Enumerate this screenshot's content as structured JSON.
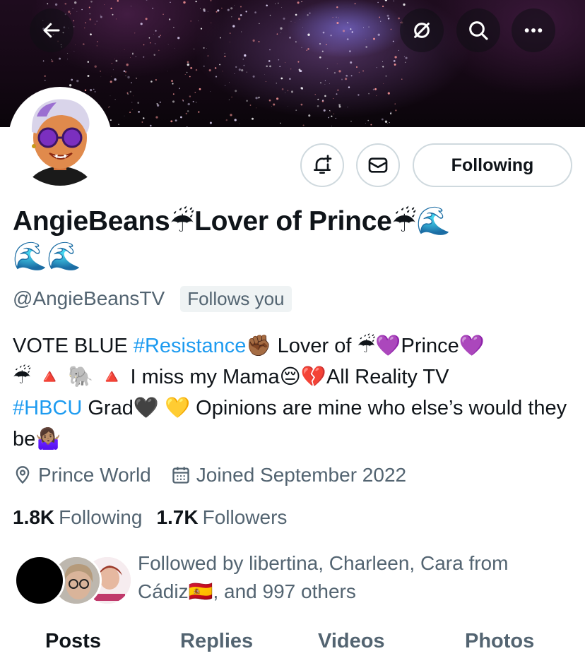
{
  "header": {
    "back_icon": "arrow-left-icon",
    "no_sync_icon": "circle-slash-icon",
    "search_icon": "search-icon",
    "more_icon": "ellipsis-icon"
  },
  "profile": {
    "display_name": "AngieBeans☔Lover of Prince☔🌊🌊🌊",
    "name_part1": "AngieBeans",
    "name_part2": "Lover of Prince",
    "handle": "@AngieBeansTV",
    "follows_you": "Follows you",
    "follow_button": "Following"
  },
  "bio": {
    "t1": "VOTE BLUE ",
    "tag1": "#Resistance",
    "t2": "✊🏾",
    "t3": "Lover of ",
    "t4": "☔💜",
    "t5": "Prince",
    "t6": "💜",
    "line2_emoji": "☔ 🔺 🐘 🔺",
    "t7": " I miss my Mama",
    "t8": "😔💔",
    "t9": "All Reality TV",
    "tag2": "#HBCU",
    "t10": " Grad",
    "t11": "🖤 💛",
    "t12": " Opinions are mine who else’s would they be",
    "t13": "🤷🏽‍♀️"
  },
  "meta": {
    "location": "Prince World",
    "joined": "Joined September 2022"
  },
  "stats": {
    "following_count": "1.8K",
    "following_label": "Following",
    "followers_count": "1.7K",
    "followers_label": "Followers"
  },
  "followed_by": {
    "line1": "Followed by libertina, Charleen, Cara from",
    "line2_a": "Cádiz",
    "line2_flag": "🇪🇸",
    "line2_b": ", and 997 others"
  },
  "tabs": [
    "Posts",
    "Replies",
    "Videos",
    "Photos"
  ],
  "colors": {
    "link": "#1d9bf0",
    "secondary_text": "#536471",
    "primary_text": "#0f1419",
    "border": "#cfd9de"
  }
}
